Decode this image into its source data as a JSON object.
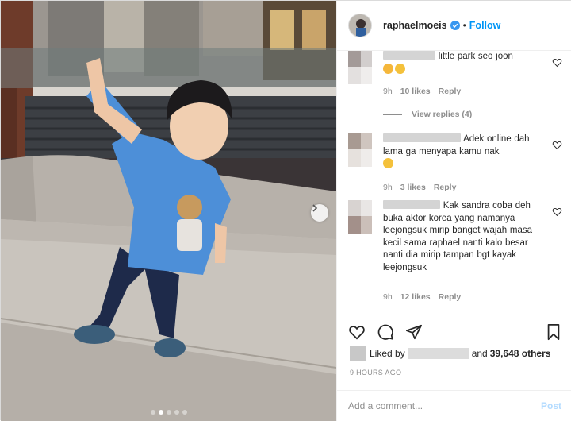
{
  "post": {
    "username": "raphaelmoeis",
    "dot": "•",
    "follow_label": "Follow",
    "carousel": {
      "slides": 5,
      "active_index": 1
    }
  },
  "comments": [
    {
      "text": "little park seo joon",
      "time": "9h",
      "likes": "10 likes",
      "reply_label": "Reply",
      "emojis": [
        "heart-eyes-emoji",
        "rofl-emoji"
      ]
    },
    {
      "text": "Adek online dah lama ga menyapa kamu nak",
      "time": "9h",
      "likes": "3 likes",
      "reply_label": "Reply",
      "emojis": [
        "joy-emoji"
      ]
    },
    {
      "text": "Kak sandra coba deh buka aktor korea yang namanya leejongsuk mirip banget wajah masa kecil sama raphael nanti kalo besar nanti dia mirip tampan bgt kayak leejongsuk",
      "time": "9h",
      "likes": "12 likes",
      "reply_label": "Reply",
      "emojis": []
    }
  ],
  "view_replies_label": "View replies (4)",
  "likes_summary": {
    "prefix": "Liked by",
    "and_label": "and",
    "others": "39,648 others"
  },
  "time_ago": "9 HOURS AGO",
  "add_comment": {
    "placeholder": "Add a comment...",
    "post_label": "Post"
  },
  "colors": {
    "accent": "#0095f6",
    "verified": "#3897f0",
    "muted": "#8e8e8e",
    "post_disabled": "#b3dbff"
  }
}
